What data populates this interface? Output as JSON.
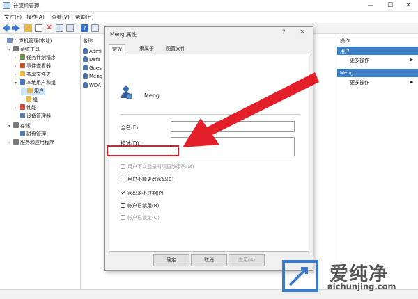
{
  "window": {
    "title": "计算机管理",
    "controls": {
      "minimize": "—",
      "maximize": "☐",
      "close": "✕"
    }
  },
  "menubar": [
    "文件(F)",
    "操作(A)",
    "查看(V)",
    "帮助(H)"
  ],
  "tree": [
    {
      "label": "计算机管理(本地)",
      "indent": 0,
      "exp": "",
      "icon": "computer-management-icon",
      "color": "#6d8fb8"
    },
    {
      "label": "系统工具",
      "indent": 1,
      "exp": "▾",
      "icon": "tools-icon",
      "color": "#7a7a7a"
    },
    {
      "label": "任务计划程序",
      "indent": 2,
      "exp": "›",
      "icon": "task-scheduler-icon",
      "color": "#6b8e4e"
    },
    {
      "label": "事件查看器",
      "indent": 2,
      "exp": "›",
      "icon": "event-viewer-icon",
      "color": "#b8572b"
    },
    {
      "label": "共享文件夹",
      "indent": 2,
      "exp": "›",
      "icon": "shared-folder-icon",
      "color": "#e5b84f"
    },
    {
      "label": "本地用户和组",
      "indent": 2,
      "exp": "▾",
      "icon": "users-groups-icon",
      "color": "#4a75b5"
    },
    {
      "label": "用户",
      "indent": 3,
      "exp": "",
      "icon": "folder-icon",
      "color": "#e5b84f",
      "selected": true
    },
    {
      "label": "组",
      "indent": 3,
      "exp": "",
      "icon": "folder-icon",
      "color": "#e5b84f"
    },
    {
      "label": "性能",
      "indent": 2,
      "exp": "›",
      "icon": "performance-icon",
      "color": "#c94a3a"
    },
    {
      "label": "设备管理器",
      "indent": 2,
      "exp": "",
      "icon": "device-manager-icon",
      "color": "#5a7ea9"
    },
    {
      "label": "存储",
      "indent": 1,
      "exp": "▾",
      "icon": "storage-icon",
      "color": "#7a7a7a"
    },
    {
      "label": "磁盘管理",
      "indent": 2,
      "exp": "",
      "icon": "disk-management-icon",
      "color": "#5a7ea9"
    },
    {
      "label": "服务和应用程序",
      "indent": 1,
      "exp": "›",
      "icon": "services-icon",
      "color": "#7a7a7a"
    }
  ],
  "list": {
    "header": "名称",
    "items": [
      "Admi",
      "Defa",
      "Gues",
      "Meng",
      "WDA"
    ]
  },
  "actions": {
    "header": "操作",
    "sections": [
      {
        "title": "用户",
        "more": "更多操作"
      },
      {
        "title": "Meng",
        "more": "更多操作"
      }
    ]
  },
  "dialog": {
    "title": "Meng 属性",
    "help": "?",
    "close": "✕",
    "tabs": [
      "常规",
      "隶属于",
      "配置文件"
    ],
    "username": "Meng",
    "fullname_label": "全名(F):",
    "fullname_value": "",
    "desc_label": "描述(D):",
    "desc_value": "",
    "checkboxes": [
      {
        "label": "用户下次登录时须更改密码(M)",
        "checked": false,
        "disabled": true
      },
      {
        "label": "用户不能更改密码(C)",
        "checked": false,
        "disabled": false
      },
      {
        "label": "密码永不过期(P)",
        "checked": true,
        "disabled": false
      },
      {
        "label": "帐户已禁用(B)",
        "checked": false,
        "disabled": false
      },
      {
        "label": "帐户已锁定(O)",
        "checked": false,
        "disabled": true
      }
    ],
    "buttons": {
      "ok": "确定",
      "cancel": "取消",
      "apply": "应用(A)"
    }
  },
  "watermark": {
    "title": "爱纯净",
    "url": "aichunjing.com"
  },
  "colors": {
    "highlight": "#e3202a",
    "accent": "#3d7fc4"
  }
}
